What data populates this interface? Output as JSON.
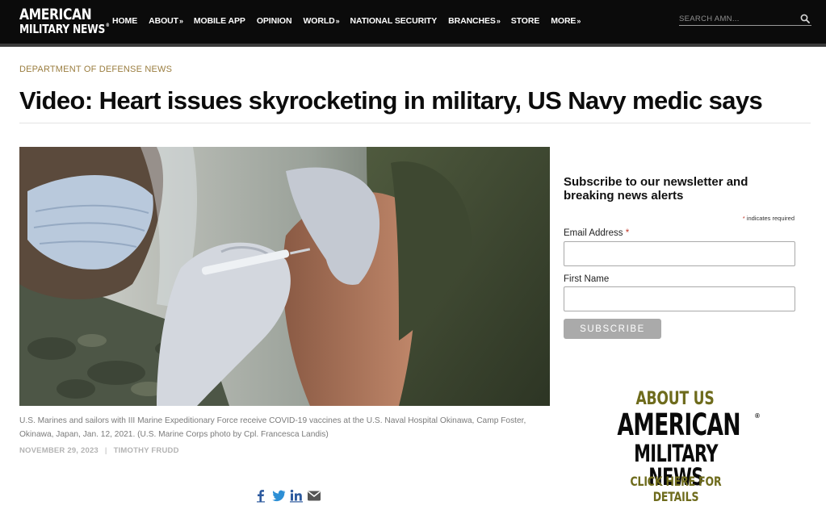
{
  "site": {
    "logo_line1": "AMERICAN",
    "logo_line2": "MILITARY NEWS",
    "logo_reg": "®"
  },
  "nav": {
    "items": [
      {
        "label": "HOME",
        "caret": ""
      },
      {
        "label": "ABOUT",
        "caret": "»"
      },
      {
        "label": "MOBILE APP",
        "caret": ""
      },
      {
        "label": "OPINION",
        "caret": ""
      },
      {
        "label": "WORLD",
        "caret": "»"
      },
      {
        "label": "NATIONAL SECURITY",
        "caret": ""
      },
      {
        "label": "BRANCHES",
        "caret": "»"
      },
      {
        "label": "STORE",
        "caret": ""
      },
      {
        "label": "MORE",
        "caret": "»"
      }
    ]
  },
  "search": {
    "placeholder": "SEARCH AMN...",
    "icon": "search-icon"
  },
  "article": {
    "category": "DEPARTMENT OF DEFENSE NEWS",
    "title": "Video: Heart issues skyrocketing in military, US Navy medic says",
    "caption": "U.S. Marines and sailors with III Marine Expeditionary Force receive COVID-19 vaccines at the U.S. Naval Hospital Okinawa, Camp Foster, Okinawa, Japan, Jan. 12, 2021. (U.S. Marine Corps photo by Cpl. Francesca Landis)",
    "date": "NOVEMBER 29, 2023",
    "separator": "|",
    "author": "TIMOTHY FRUDD",
    "share_icons": [
      "facebook-icon",
      "twitter-icon",
      "linkedin-icon",
      "email-icon"
    ]
  },
  "newsletter": {
    "title": "Subscribe to our newsletter and breaking news alerts",
    "required_mark": "*",
    "required_note": "indicates required",
    "email_label": "Email Address",
    "email_value": "",
    "first_name_label": "First Name",
    "first_name_value": "",
    "button_label": "SUBSCRIBE"
  },
  "about_ad": {
    "heading": "ABOUT US",
    "brand_line1": "AMERICAN",
    "brand_reg": "®",
    "brand_line2": "MILITARY NEWS",
    "cta": "CLICK HERE FOR DETAILS"
  },
  "colors": {
    "nav_bg": "#0b0b0b",
    "category": "#9a7d3f",
    "ad_olive": "#6e6b1c",
    "button_gray": "#aaaaaa",
    "share_blue": "#2d5a9e"
  }
}
